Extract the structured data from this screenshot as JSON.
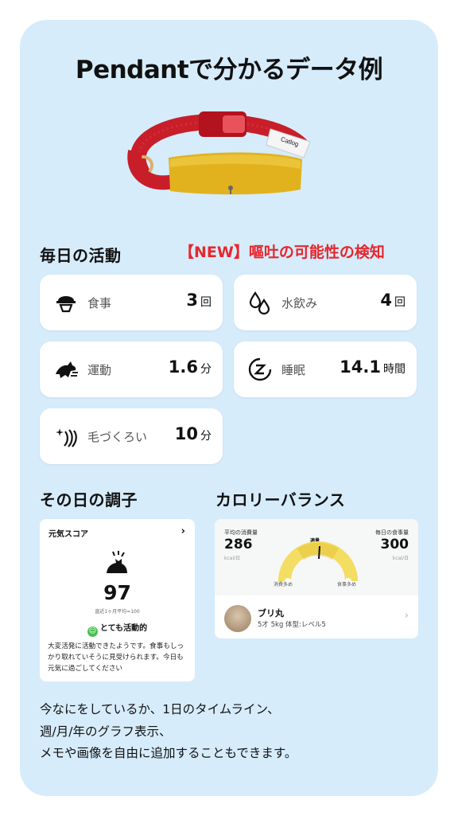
{
  "title": "Pendantで分かるデータ例",
  "collar": {
    "tag_text": "Catlog"
  },
  "daily": {
    "heading": "毎日の活動",
    "new_alert": "【NEW】嘔吐の可能性の検知",
    "tiles": [
      {
        "icon": "food-bowl-icon",
        "label": "食事",
        "value": "3",
        "unit": "回"
      },
      {
        "icon": "water-drop-icon",
        "label": "水飲み",
        "value": "4",
        "unit": "回"
      },
      {
        "icon": "running-cat-icon",
        "label": "運動",
        "value": "1.6",
        "unit": "分"
      },
      {
        "icon": "sleep-icon",
        "label": "睡眠",
        "value": "14.1",
        "unit": "時間"
      },
      {
        "icon": "grooming-icon",
        "label": "毛づくろい",
        "value": "10",
        "unit": "分"
      }
    ]
  },
  "condition": {
    "heading": "その日の調子",
    "card": {
      "header": "元気スコア",
      "chevron": "›",
      "score": "97",
      "average": "直近1ヶ月平均=100",
      "status": "とても活動的",
      "description": "大変活発に活動できたようです。食事もしっかり取れていそうに見受けられます。今日も元気に過ごしてください"
    }
  },
  "calorie": {
    "heading": "カロリーバランス",
    "card": {
      "left_label": "平均の消費量",
      "left_value": "286",
      "left_unit": "kcal/日",
      "right_label": "毎日の食事量",
      "right_value": "300",
      "right_unit": "kcal/日",
      "center_label": "適量",
      "left_scale": "消費多め",
      "right_scale": "食事多め",
      "pet_name": "ブリ丸",
      "pet_info": "5才 5kg 体型:レベル5",
      "chevron": "›"
    }
  },
  "footer": {
    "line1": "今なにをしているか、1日のタイムライン、",
    "line2": "週/月/年のグラフ表示、",
    "line3": "メモや画像を自由に追加することもできます。"
  },
  "colors": {
    "background": "#d6ecfb",
    "alert": "#e8262c",
    "collar_red": "#d41f2b",
    "pendant_gold": "#e2b21e",
    "gauge_yellow": "#f3dd63",
    "status_green": "#49c04f"
  }
}
